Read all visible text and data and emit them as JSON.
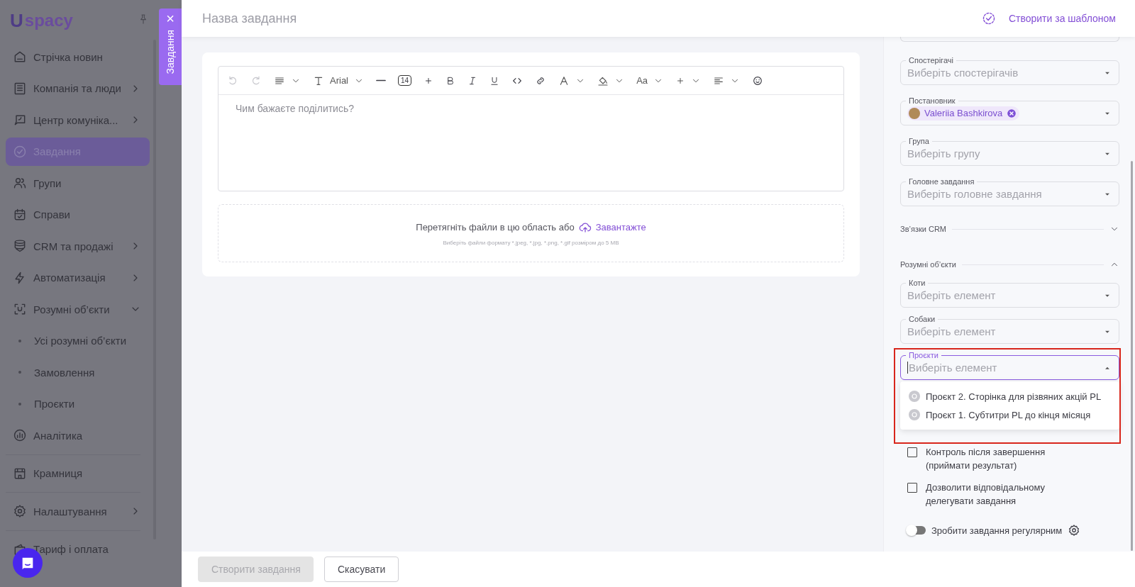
{
  "sidebar": {
    "logo": {
      "mark": "U",
      "text": "spacy"
    },
    "items": [
      {
        "kind": "link",
        "label": "Стрічка новин",
        "selected": false
      },
      {
        "kind": "group",
        "label": "Компанія та люди",
        "selected": false,
        "expanded": false
      },
      {
        "kind": "group",
        "label": "Центр комуніка...",
        "selected": false,
        "expanded": false
      },
      {
        "kind": "link",
        "label": "Завдання",
        "selected": true
      },
      {
        "kind": "link",
        "label": "Групи",
        "selected": false
      },
      {
        "kind": "link",
        "label": "Справи",
        "selected": false
      },
      {
        "kind": "group",
        "label": "CRM та продажі",
        "selected": false,
        "expanded": false
      },
      {
        "kind": "group",
        "label": "Автоматизація",
        "selected": false,
        "expanded": false
      },
      {
        "kind": "group",
        "label": "Розумні об’єкти",
        "selected": false,
        "expanded": true,
        "children": [
          {
            "kind": "link",
            "label": "Усі розумні об’єкти",
            "selected": false
          },
          {
            "kind": "link",
            "label": "Замовлення",
            "selected": false
          },
          {
            "kind": "link",
            "label": "Проєкти",
            "selected": false
          }
        ]
      },
      {
        "kind": "link",
        "label": "Аналітика",
        "selected": false
      },
      {
        "kind": "divider"
      },
      {
        "kind": "link",
        "label": "Крамниця",
        "selected": false
      },
      {
        "kind": "divider"
      },
      {
        "kind": "group",
        "label": "Налаштування",
        "selected": false,
        "expanded": false
      },
      {
        "kind": "divider"
      },
      {
        "kind": "link",
        "label": "Тариф і оплата",
        "selected": false
      }
    ]
  },
  "side_tab": {
    "label": "Завдання",
    "close": "×"
  },
  "header": {
    "title_placeholder": "Назва завдання",
    "template_link": "Створити за шаблоном"
  },
  "editor": {
    "font": "Arial",
    "font_size": "14",
    "case_label": "Aa",
    "placeholder": "Чим бажаєте поділитись?"
  },
  "upload": {
    "text": "Перетягніть файли в цю область або",
    "link": "Завантажте",
    "hint": "Виберіть файли формату *.jpeg, *.jpg, *.png, *.gif розміром до 5 MB"
  },
  "side_panel": {
    "items": [
      {
        "kind": "select_edge"
      },
      {
        "kind": "select",
        "label": "Спостерігачі",
        "placeholder": "Виберіть спостерігачів",
        "focused": false,
        "highlighted": false
      },
      {
        "kind": "select",
        "label": "Постановник",
        "chips": [
          {
            "name": "Valeriia Bashkirova"
          }
        ],
        "focused": false,
        "highlighted": false
      },
      {
        "kind": "select",
        "label": "Група",
        "placeholder": "Виберіть групу",
        "focused": false,
        "highlighted": false
      },
      {
        "kind": "select",
        "label": "Головне завдання",
        "placeholder": "Виберіть головне завдання",
        "focused": false,
        "highlighted": false
      },
      {
        "kind": "section",
        "label": "Зв’язки CRM",
        "expanded": false
      },
      {
        "kind": "section",
        "label": "Розумні об’єкти",
        "expanded": true
      },
      {
        "kind": "select",
        "label": "Коти",
        "placeholder": "Виберіть елемент",
        "focused": false,
        "highlighted": false
      },
      {
        "kind": "select",
        "label": "Собаки",
        "placeholder": "Виберіть елемент",
        "focused": false,
        "highlighted": false
      },
      {
        "kind": "select",
        "label": "Проєкти",
        "placeholder": "Виберіть елемент",
        "focused": true,
        "highlighted": true,
        "options": [
          {
            "label": "Проєкт 2. Сторінка для різвяних акцій PL"
          },
          {
            "label": "Проєкт 1. Субтитри PL до кінця місяця"
          }
        ]
      },
      {
        "kind": "checkbox",
        "label": "Контроль після завершення (приймати результат)",
        "checked": false
      },
      {
        "kind": "checkbox",
        "label": "Дозволити відповідальному делегувати завдання",
        "checked": false
      },
      {
        "kind": "toggle",
        "label": "Зробити завдання регулярним",
        "on": false
      }
    ]
  },
  "footer": {
    "buttons": [
      {
        "label": "Створити завдання",
        "disabled": true
      },
      {
        "label": "Скасувати",
        "disabled": false
      }
    ]
  }
}
